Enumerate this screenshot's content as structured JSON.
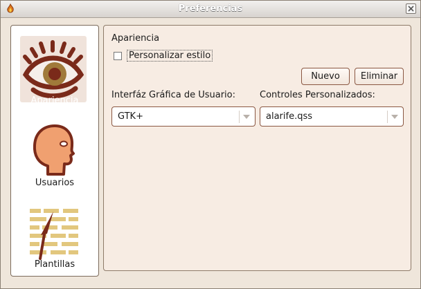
{
  "window": {
    "title": "Preferencias"
  },
  "sidebar": {
    "items": [
      {
        "label": "Apariencia",
        "icon": "eye-icon",
        "selected": true
      },
      {
        "label": "Usuarios",
        "icon": "user-head-icon",
        "selected": false
      },
      {
        "label": "Plantillas",
        "icon": "brick-wall-trowel-icon",
        "selected": false
      }
    ]
  },
  "appearance": {
    "group_title": "Apariencia",
    "custom_style_label": "Personalizar estilo",
    "custom_style_checked": false,
    "new_button": "Nuevo",
    "delete_button": "Eliminar",
    "gui_label": "Interfáz Gráfica de Usuario:",
    "gui_value": "GTK+",
    "custom_controls_label": "Controles Personalizados:",
    "custom_controls_value": "alarife.qss"
  },
  "colors": {
    "accent": "#7a2a1a",
    "window_bg": "#efe6db",
    "panel_bg": "#f7ece3",
    "skin": "#f0a070",
    "wall": "#e2c77e"
  }
}
